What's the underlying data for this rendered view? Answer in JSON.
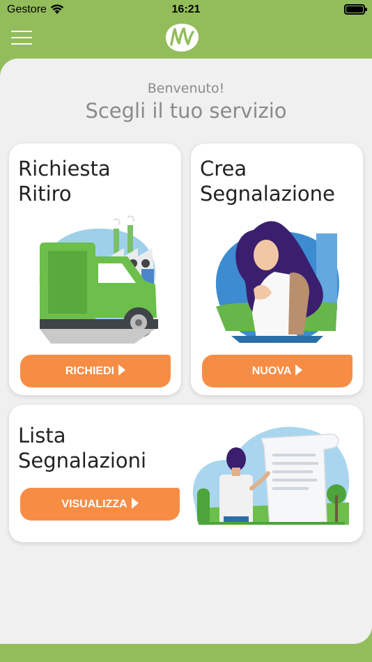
{
  "status_bar": {
    "carrier": "Gestore",
    "time": "16:21"
  },
  "header": {
    "menu_icon": "hamburger-menu-icon",
    "logo_icon": "app-logo-icon"
  },
  "intro": {
    "welcome": "Benvenuto!",
    "title": "Scegli il tuo servizio"
  },
  "cards": {
    "pickup": {
      "title_line1": "Richiesta",
      "title_line2": "Ritiro",
      "button": "RICHIEDI",
      "illustration": "garbage-truck-illustration"
    },
    "report": {
      "title_line1": "Crea",
      "title_line2": "Segnalazione",
      "button": "NUOVA",
      "illustration": "woman-phone-illustration"
    },
    "list": {
      "title_line1": "Lista",
      "title_line2": "Segnalazioni",
      "button": "VISUALIZZA",
      "illustration": "document-scroll-illustration"
    }
  },
  "colors": {
    "brand_green": "#93bd5a",
    "accent_orange": "#f78d45",
    "background": "#f0f0f0",
    "card": "#ffffff"
  }
}
